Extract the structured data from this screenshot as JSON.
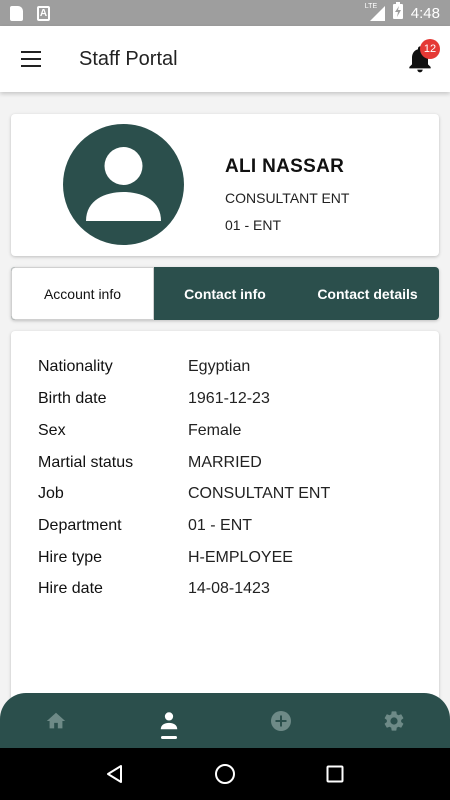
{
  "status_bar": {
    "time": "4:48",
    "network": "LTE",
    "icons": [
      "sd-card-icon",
      "font-a-icon",
      "signal-icon",
      "battery-charging-icon"
    ]
  },
  "app_bar": {
    "title": "Staff Portal",
    "notification_count": "12"
  },
  "profile": {
    "name": "ALI NASSAR",
    "job_title": "CONSULTANT ENT",
    "department": "01 - ENT"
  },
  "tabs": [
    {
      "label": "Account info",
      "active": true
    },
    {
      "label": "Contact info",
      "active": false
    },
    {
      "label": "Contact details",
      "active": false
    }
  ],
  "account_info": [
    {
      "label": "Nationality",
      "value": "Egyptian"
    },
    {
      "label": "Birth date",
      "value": "1961-12-23"
    },
    {
      "label": "Sex",
      "value": "Female"
    },
    {
      "label": "Martial status",
      "value": "MARRIED"
    },
    {
      "label": "Job",
      "value": "CONSULTANT ENT"
    },
    {
      "label": "Department",
      "value": "01 - ENT"
    },
    {
      "label": "Hire type",
      "value": "H-EMPLOYEE"
    },
    {
      "label": "Hire date",
      "value": "14-08-1423"
    }
  ],
  "bottom_nav": {
    "items": [
      "home-icon",
      "profile-icon",
      "add-circle-icon",
      "settings-icon"
    ],
    "active": "profile-icon"
  },
  "colors": {
    "primary": "#2b4f4c",
    "badge": "#e53935",
    "status_bar": "#9e9e9e",
    "nav_icon_inactive": "#6e8a87"
  }
}
